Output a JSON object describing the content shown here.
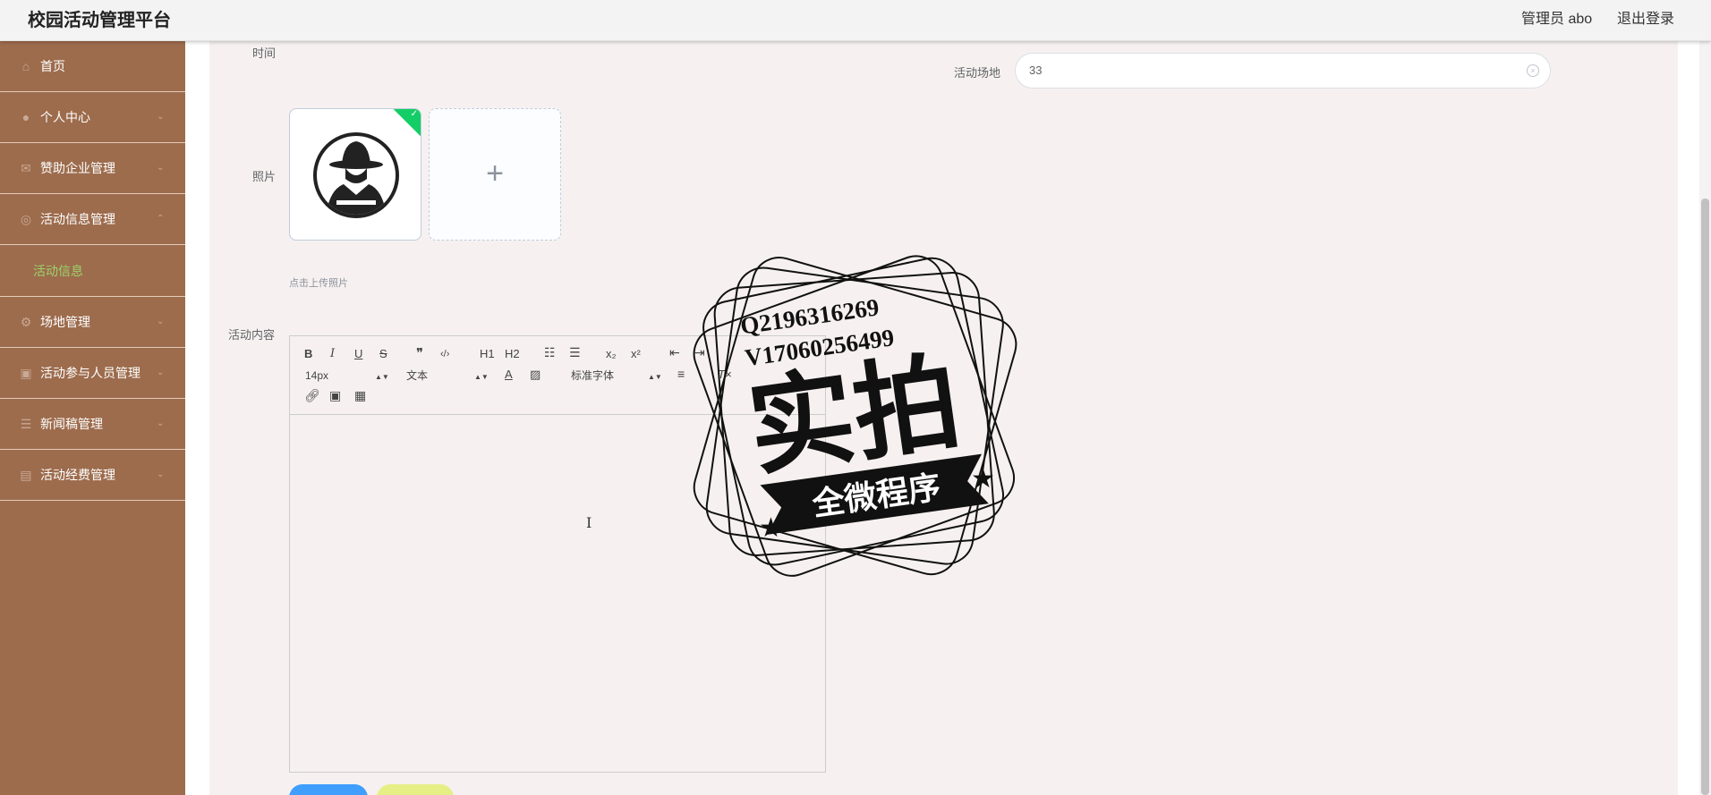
{
  "header": {
    "title": "校园活动管理平台",
    "user": "管理员 abo",
    "logout": "退出登录"
  },
  "sidebar": {
    "items": [
      {
        "label": "首页",
        "icon": "home-icon"
      },
      {
        "label": "个人中心",
        "icon": "user-icon"
      },
      {
        "label": "赞助企业管理",
        "icon": "mail-icon"
      },
      {
        "label": "活动信息管理",
        "icon": "compass-icon",
        "expanded": true
      },
      {
        "label": "活动信息",
        "sub": true
      },
      {
        "label": "场地管理",
        "icon": "gear-icon"
      },
      {
        "label": "活动参与人员管理",
        "icon": "picture-icon"
      },
      {
        "label": "新闻稿管理",
        "icon": "sliders-icon"
      },
      {
        "label": "活动经费管理",
        "icon": "briefcase-icon"
      }
    ]
  },
  "form": {
    "time_label": "时间",
    "venue_label": "活动场地",
    "venue_value": "33",
    "photo_label": "照片",
    "photo_hint": "点击上传照片",
    "content_label": "活动内容",
    "upload_plus": "+"
  },
  "editor": {
    "font_size": "14px",
    "header_select": "文本",
    "font_family": "标准字体",
    "buttons": [
      "B",
      "I",
      "U",
      "S",
      "❞",
      "‹/›",
      "H1",
      "H2",
      "x₂",
      "x²"
    ]
  },
  "watermark": {
    "line1": "Q2196316269",
    "line2": "V17060256499",
    "big": "实拍",
    "banner": "全微程序"
  },
  "colors": {
    "sidebar_bg": "#9d6c4d",
    "active_sub": "#9bd36b",
    "content_bg": "#f6f1f0",
    "primary": "#409eff",
    "success": "#13ce66"
  }
}
